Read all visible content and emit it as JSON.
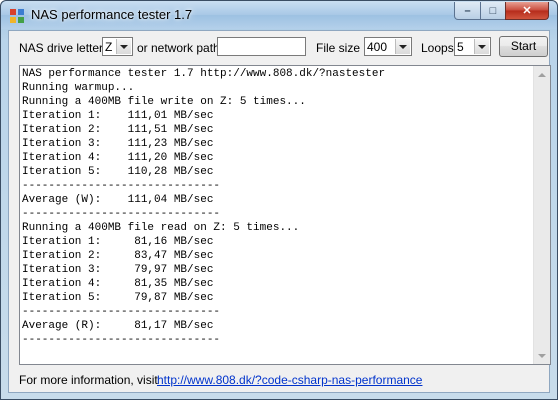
{
  "window": {
    "title": "NAS performance tester 1.7",
    "min_glyph": "–",
    "max_glyph": "□",
    "close_glyph": "✕"
  },
  "toolbar": {
    "drive_letter_label": "NAS drive letter",
    "drive_letter_value": "Z",
    "network_path_label": "or network path",
    "network_path_value": "",
    "file_size_label": "File size",
    "file_size_value": "400",
    "loops_label": "Loops",
    "loops_value": "5",
    "start_label": "Start"
  },
  "output": {
    "text": "NAS performance tester 1.7 http://www.808.dk/?nastester\nRunning warmup...\nRunning a 400MB file write on Z: 5 times...\nIteration 1:    111,01 MB/sec\nIteration 2:    111,51 MB/sec\nIteration 3:    111,23 MB/sec\nIteration 4:    111,20 MB/sec\nIteration 5:    110,28 MB/sec\n------------------------------\nAverage (W):    111,04 MB/sec\n------------------------------\nRunning a 400MB file read on Z: 5 times...\nIteration 1:     81,16 MB/sec\nIteration 2:     83,47 MB/sec\nIteration 3:     79,97 MB/sec\nIteration 4:     81,35 MB/sec\nIteration 5:     79,87 MB/sec\n------------------------------\nAverage (R):     81,17 MB/sec\n------------------------------"
  },
  "footer": {
    "info_label": "For more information, visit",
    "link_text": "http://www.808.dk/?code-csharp-nas-performance"
  },
  "colors": {
    "link": "#0033cc",
    "title_bar": "#a8c8e6",
    "close_button": "#c8493a"
  }
}
